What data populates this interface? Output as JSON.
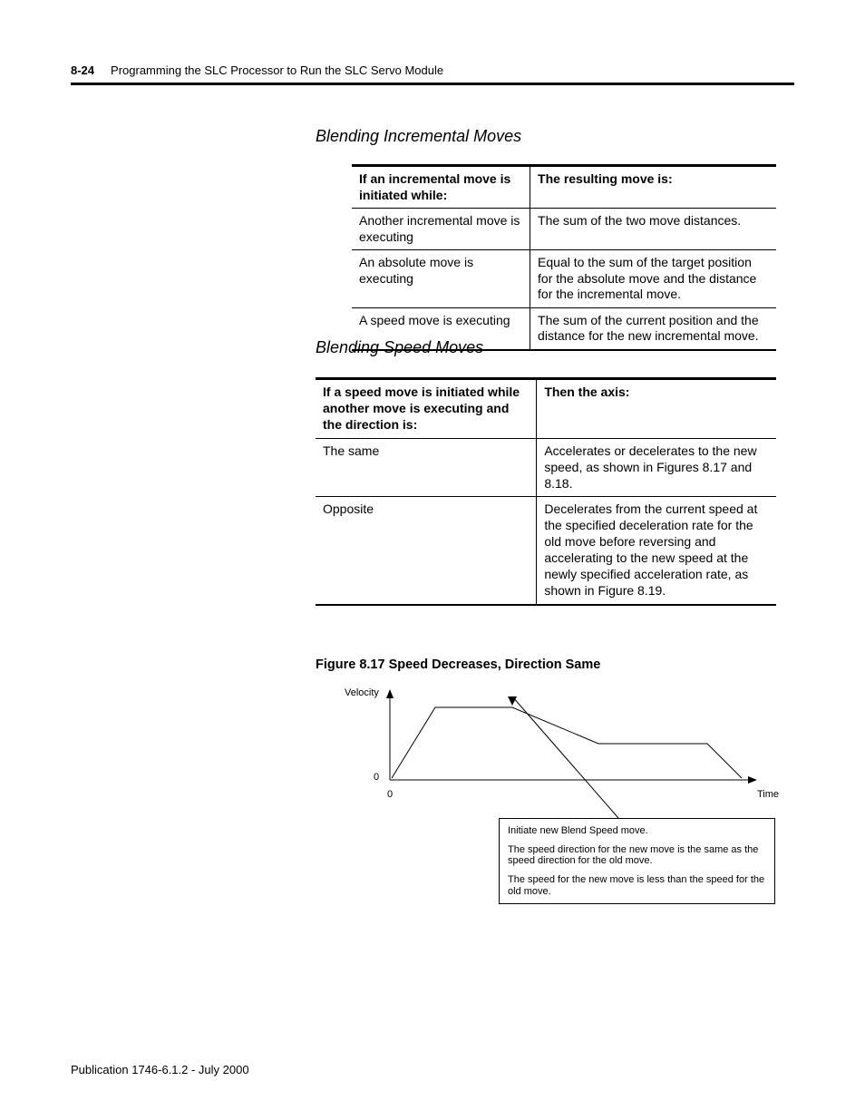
{
  "header": {
    "page_number": "8-24",
    "chapter_title": "Programming the SLC Processor to Run the SLC Servo Module"
  },
  "section1": {
    "heading": "Blending Incremental Moves",
    "table": {
      "head_col1": "If an incremental move is initiated while:",
      "head_col2": "The resulting move is:",
      "rows": [
        {
          "c1": "Another incremental move is executing",
          "c2": "The sum of the two move distances."
        },
        {
          "c1": "An absolute move is executing",
          "c2": "Equal to the sum of the target position for the absolute move and the distance for the incremental move."
        },
        {
          "c1": "A speed move is executing",
          "c2": "The sum of the current position and the distance for the new incremental move."
        }
      ]
    }
  },
  "section2": {
    "heading": "Blending Speed Moves",
    "table": {
      "head_col1": "If a speed move is initiated while another move is executing and the direction is:",
      "head_col2": "Then the axis:",
      "rows": [
        {
          "c1": "The same",
          "c2": "Accelerates or decelerates to the new speed, as shown in Figures 8.17 and 8.18."
        },
        {
          "c1": "Opposite",
          "c2": "Decelerates from the current speed at the specified deceleration rate for the old move before reversing and accelerating to the new speed at the newly specified acceleration rate, as shown in Figure 8.19."
        }
      ]
    }
  },
  "figure": {
    "caption": "Figure 8.17 Speed Decreases, Direction Same",
    "y_label": "Velocity",
    "x_label": "Time",
    "zero": "0",
    "callout": {
      "line1": "Initiate new Blend Speed move.",
      "line2": "The speed direction for the new move is the same as the speed direction for the old move.",
      "line3": "The speed for the new move is less than the speed for the old move."
    }
  },
  "chart_data": {
    "type": "line",
    "title": "Speed Decreases, Direction Same",
    "xlabel": "Time",
    "ylabel": "Velocity",
    "series": [
      {
        "name": "velocity-profile",
        "points": [
          [
            0,
            0
          ],
          [
            1,
            2
          ],
          [
            2.2,
            2
          ],
          [
            3.8,
            1
          ],
          [
            7,
            1
          ],
          [
            8,
            0
          ]
        ]
      }
    ],
    "annotation_marker_x": 2.2
  },
  "footer": {
    "publication": "Publication 1746-6.1.2 - July 2000"
  }
}
